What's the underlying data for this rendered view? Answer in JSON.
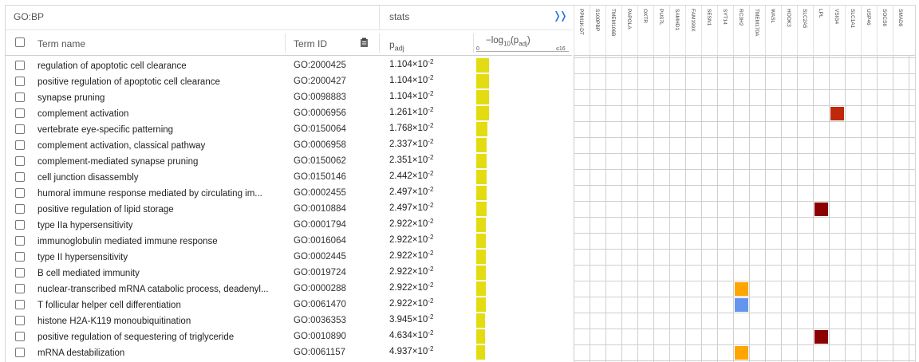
{
  "header": {
    "section_label": "GO:BP",
    "stats_label": "stats",
    "expand_icon_glyph": "❭❭",
    "columns": {
      "term_name": "Term name",
      "term_id": "Term ID",
      "padj": "p",
      "padj_sub": "adj",
      "neglog_prefix": "−log",
      "neglog_base": "10",
      "neglog_open": "(p",
      "neglog_sub": "adj",
      "neglog_close": ")",
      "scale_min": "0",
      "scale_max": "≤16"
    }
  },
  "genes": [
    "PPM1K-DT",
    "S100PBP",
    "TMEM106B",
    "PAPOLA",
    "OXTR",
    "PUS7L",
    "SAMHD1",
    "FAM199X",
    "SESN1",
    "SYT14",
    "RC3H2",
    "TMEM170A",
    "WASL",
    "HOOK3",
    "SLC2A5",
    "LPL",
    "VSIG4",
    "SLC1A1",
    "USP46",
    "SOCS6",
    "SMAD9"
  ],
  "colors": {
    "bar": "#e3dc12",
    "highlight_dark_red": "#8b0000",
    "highlight_red": "#c0280d",
    "highlight_orange": "#ffa500",
    "highlight_blue": "#6495ed",
    "link_blue": "#1a73e8"
  },
  "rows": [
    {
      "name": "regulation of apoptotic cell clearance",
      "id": "GO:2000425",
      "mantissa": "1.104",
      "exponent": "-2",
      "neglog": 1.96
    },
    {
      "name": "positive regulation of apoptotic cell clearance",
      "id": "GO:2000427",
      "mantissa": "1.104",
      "exponent": "-2",
      "neglog": 1.96
    },
    {
      "name": "synapse pruning",
      "id": "GO:0098883",
      "mantissa": "1.104",
      "exponent": "-2",
      "neglog": 1.96
    },
    {
      "name": "complement activation",
      "id": "GO:0006956",
      "mantissa": "1.261",
      "exponent": "-2",
      "neglog": 1.9
    },
    {
      "name": "vertebrate eye-specific patterning",
      "id": "GO:0150064",
      "mantissa": "1.768",
      "exponent": "-2",
      "neglog": 1.75
    },
    {
      "name": "complement activation, classical pathway",
      "id": "GO:0006958",
      "mantissa": "2.337",
      "exponent": "-2",
      "neglog": 1.63
    },
    {
      "name": "complement-mediated synapse pruning",
      "id": "GO:0150062",
      "mantissa": "2.351",
      "exponent": "-2",
      "neglog": 1.63
    },
    {
      "name": "cell junction disassembly",
      "id": "GO:0150146",
      "mantissa": "2.442",
      "exponent": "-2",
      "neglog": 1.61
    },
    {
      "name": "humoral immune response mediated by circulating im...",
      "id": "GO:0002455",
      "mantissa": "2.497",
      "exponent": "-2",
      "neglog": 1.6
    },
    {
      "name": "positive regulation of lipid storage",
      "id": "GO:0010884",
      "mantissa": "2.497",
      "exponent": "-2",
      "neglog": 1.6
    },
    {
      "name": "type IIa hypersensitivity",
      "id": "GO:0001794",
      "mantissa": "2.922",
      "exponent": "-2",
      "neglog": 1.53
    },
    {
      "name": "immunoglobulin mediated immune response",
      "id": "GO:0016064",
      "mantissa": "2.922",
      "exponent": "-2",
      "neglog": 1.53
    },
    {
      "name": "type II hypersensitivity",
      "id": "GO:0002445",
      "mantissa": "2.922",
      "exponent": "-2",
      "neglog": 1.53
    },
    {
      "name": "B cell mediated immunity",
      "id": "GO:0019724",
      "mantissa": "2.922",
      "exponent": "-2",
      "neglog": 1.53
    },
    {
      "name": "nuclear-transcribed mRNA catabolic process, deadenyl...",
      "id": "GO:0000288",
      "mantissa": "2.922",
      "exponent": "-2",
      "neglog": 1.53
    },
    {
      "name": "T follicular helper cell differentiation",
      "id": "GO:0061470",
      "mantissa": "2.922",
      "exponent": "-2",
      "neglog": 1.53
    },
    {
      "name": "histone H2A-K119 monoubiquitination",
      "id": "GO:0036353",
      "mantissa": "3.945",
      "exponent": "-2",
      "neglog": 1.4
    },
    {
      "name": "positive regulation of sequestering of triglyceride",
      "id": "GO:0010890",
      "mantissa": "4.634",
      "exponent": "-2",
      "neglog": 1.33
    },
    {
      "name": "mRNA destabilization",
      "id": "GO:0061157",
      "mantissa": "4.937",
      "exponent": "-2",
      "neglog": 1.31
    }
  ],
  "highlights": [
    {
      "row": 3,
      "gene": "VSIG4",
      "color": "#c0280d"
    },
    {
      "row": 9,
      "gene": "LPL",
      "color": "#8b0000"
    },
    {
      "row": 14,
      "gene": "RC3H2",
      "color": "#ffa500"
    },
    {
      "row": 15,
      "gene": "RC3H2",
      "color": "#6495ed"
    },
    {
      "row": 17,
      "gene": "LPL",
      "color": "#8b0000"
    },
    {
      "row": 18,
      "gene": "RC3H2",
      "color": "#ffa500"
    }
  ]
}
